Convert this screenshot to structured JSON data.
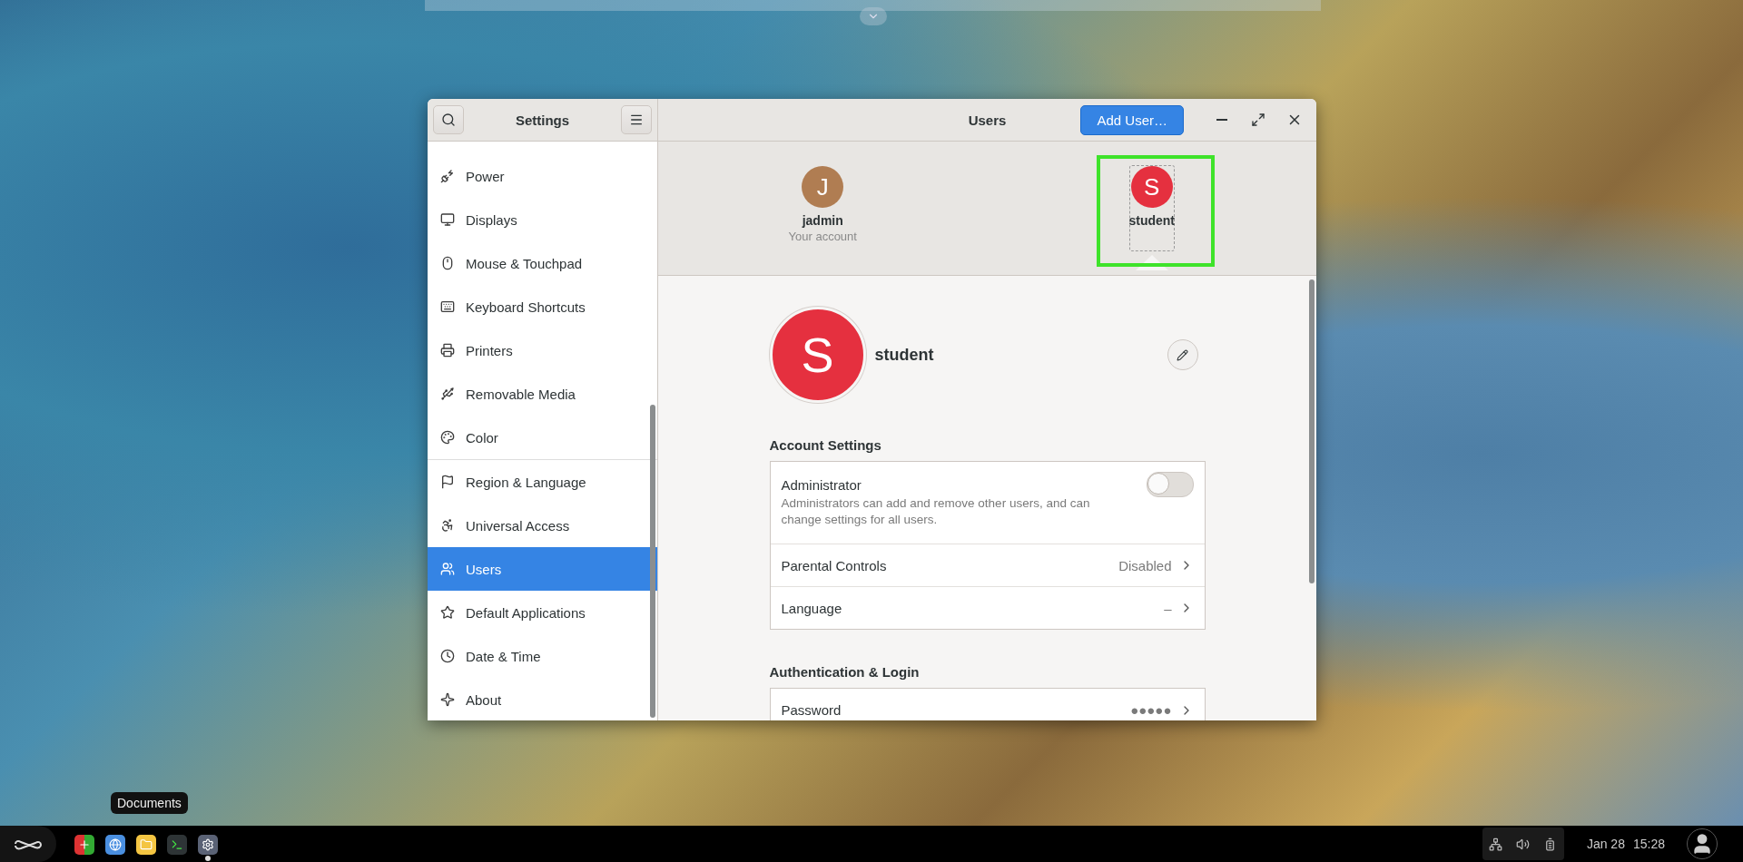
{
  "window": {
    "title": "Settings",
    "panel_title": "Users",
    "add_button": "Add User…"
  },
  "sidebar": {
    "groups": [
      {
        "items": [
          {
            "label": "Power",
            "selected": false
          },
          {
            "label": "Displays",
            "selected": false
          },
          {
            "label": "Mouse & Touchpad",
            "selected": false
          },
          {
            "label": "Keyboard Shortcuts",
            "selected": false
          },
          {
            "label": "Printers",
            "selected": false
          },
          {
            "label": "Removable Media",
            "selected": false
          },
          {
            "label": "Color",
            "selected": false
          }
        ]
      },
      {
        "items": [
          {
            "label": "Region & Language",
            "selected": false
          },
          {
            "label": "Universal Access",
            "selected": false
          },
          {
            "label": "Users",
            "selected": true
          },
          {
            "label": "Default Applications",
            "selected": false
          },
          {
            "label": "Date & Time",
            "selected": false
          },
          {
            "label": "About",
            "selected": false
          }
        ]
      }
    ]
  },
  "users": [
    {
      "initial": "J",
      "name": "jadmin",
      "subtitle": "Your account",
      "color": "#b07d52",
      "selected": false,
      "highlighted": false
    },
    {
      "initial": "S",
      "name": "student",
      "color": "#e5303f",
      "selected": true,
      "highlighted": true
    }
  ],
  "profile": {
    "initial": "S",
    "name": "student"
  },
  "sections": [
    {
      "title": "Account Settings",
      "rows": [
        {
          "kind": "toggle",
          "label": "Administrator",
          "description": "Administrators can add and remove other users, and can change settings for all users.",
          "on": false
        },
        {
          "kind": "link",
          "label": "Parental Controls",
          "value": "Disabled"
        },
        {
          "kind": "link",
          "label": "Language",
          "value": "–"
        }
      ]
    },
    {
      "title": "Authentication & Login",
      "rows": [
        {
          "kind": "link",
          "label": "Password",
          "value": "●●●●●"
        }
      ]
    }
  ],
  "taskbar": {
    "tooltip": "Documents",
    "apps": [
      {
        "kind": "software",
        "running": false
      },
      {
        "kind": "browser",
        "running": false
      },
      {
        "kind": "files",
        "running": false
      },
      {
        "kind": "terminal",
        "running": false
      },
      {
        "kind": "settings",
        "running": true
      }
    ],
    "date": "Jan 28",
    "time": "15:28"
  }
}
